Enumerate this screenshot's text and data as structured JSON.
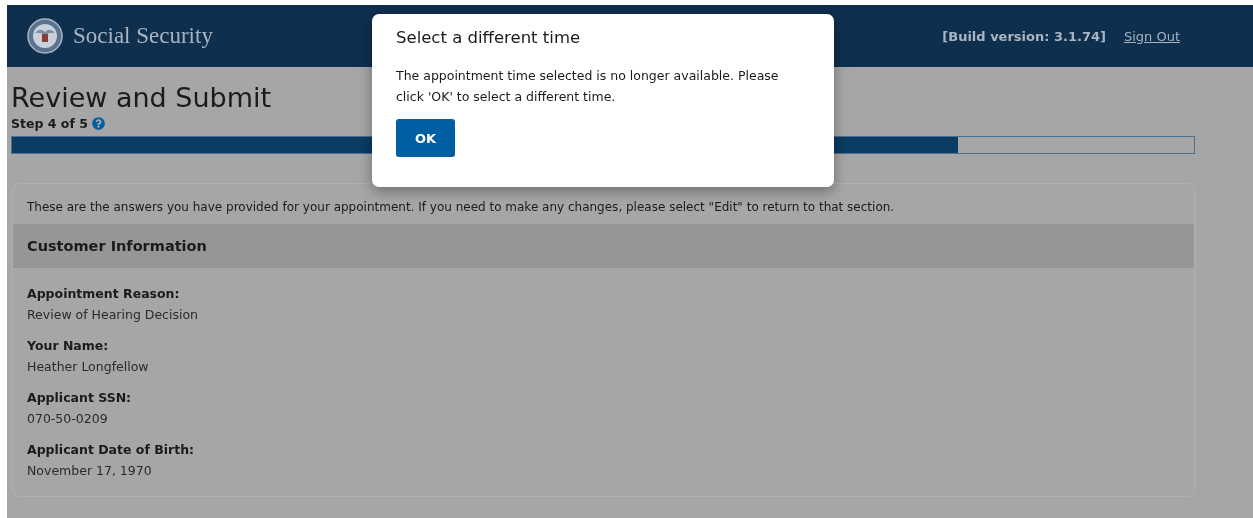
{
  "header": {
    "brand": "Social Security",
    "build_version": "[Build version: 3.1.74]",
    "sign_out": "Sign Out"
  },
  "page": {
    "title": "Review and Submit",
    "step": "Step 4 of 5",
    "progress": {
      "level": 0.8
    }
  },
  "review": {
    "intro": "These are the answers you have provided for your appointment. If you need to make any changes, please select \"Edit\" to return to that section.",
    "section_title": "Customer Information",
    "fields": [
      {
        "label": "Appointment Reason:",
        "value": "Review of Hearing Decision"
      },
      {
        "label": "Your Name:",
        "value": "Heather Longfellow"
      },
      {
        "label": "Applicant SSN:",
        "value": "070-50-0209"
      },
      {
        "label": "Applicant Date of Birth:",
        "value": "November 17, 1970"
      }
    ]
  },
  "dialog": {
    "title": "Select a different time",
    "message": "The appointment time selected is no longer available. Please click 'OK' to select a different time.",
    "button": "OK"
  }
}
